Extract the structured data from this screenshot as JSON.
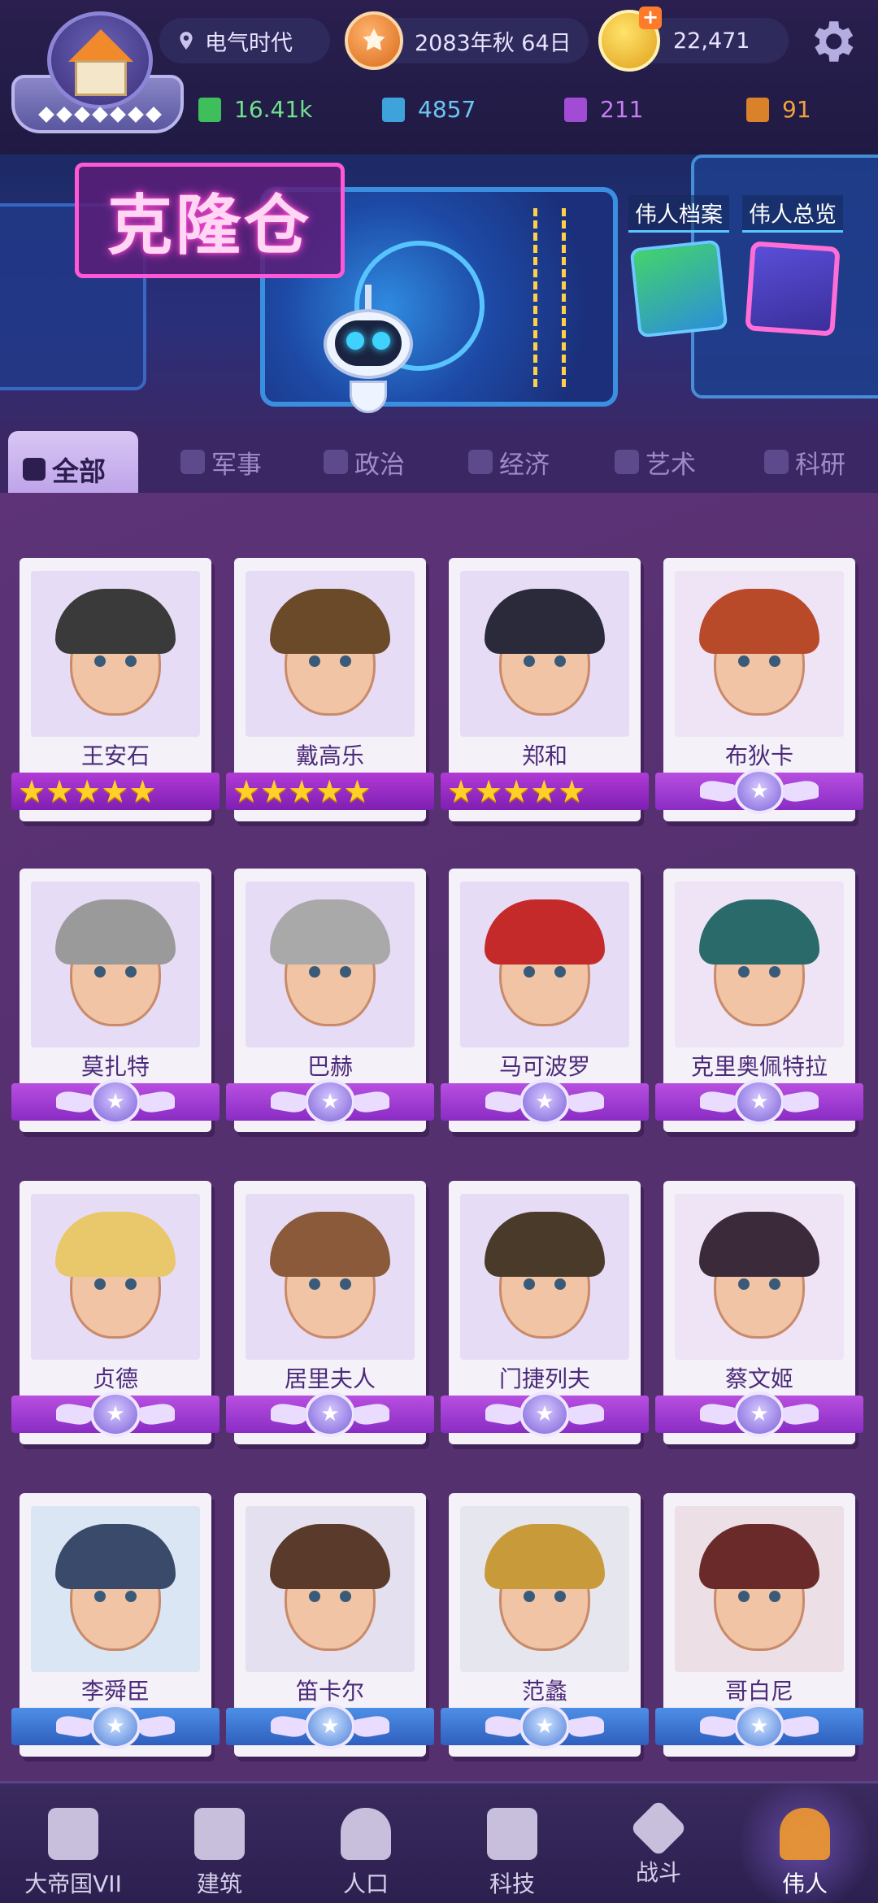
{
  "header": {
    "era": "电气时代",
    "date": "2083年秋 64日",
    "coins": "22,471",
    "resources": [
      {
        "value": "16.41k",
        "icon": "green-resource-icon",
        "color": "#6ee28a"
      },
      {
        "value": "4857",
        "icon": "blue-resource-icon",
        "color": "#6cc6f2"
      },
      {
        "value": "211",
        "icon": "purple-resource-icon",
        "color": "#c87ef0"
      },
      {
        "value": "91",
        "icon": "orange-resource-icon",
        "color": "#f2a33a"
      }
    ]
  },
  "banner": {
    "title": "克隆仓",
    "archive_label": "伟人档案",
    "overview_label": "伟人总览"
  },
  "tabs": [
    {
      "label": "全部",
      "icon": "grid-icon",
      "active": true
    },
    {
      "label": "军事",
      "icon": "shield-icon"
    },
    {
      "label": "政治",
      "icon": "building-icon"
    },
    {
      "label": "经济",
      "icon": "coins-icon"
    },
    {
      "label": "艺术",
      "icon": "palette-icon"
    },
    {
      "label": "科研",
      "icon": "flask-icon"
    }
  ],
  "heroes": [
    {
      "name": "王安石",
      "rank": "stars",
      "stars": 5
    },
    {
      "name": "戴高乐",
      "rank": "stars",
      "stars": 5
    },
    {
      "name": "郑和",
      "rank": "stars",
      "stars": 5
    },
    {
      "name": "布狄卡",
      "rank": "purple"
    },
    {
      "name": "莫扎特",
      "rank": "purple"
    },
    {
      "name": "巴赫",
      "rank": "purple"
    },
    {
      "name": "马可波罗",
      "rank": "purple"
    },
    {
      "name": "克里奥佩特拉",
      "rank": "purple"
    },
    {
      "name": "贞德",
      "rank": "purple"
    },
    {
      "name": "居里夫人",
      "rank": "purple"
    },
    {
      "name": "门捷列夫",
      "rank": "purple"
    },
    {
      "name": "蔡文姬",
      "rank": "purple"
    },
    {
      "name": "李舜臣",
      "rank": "blue"
    },
    {
      "name": "笛卡尔",
      "rank": "blue"
    },
    {
      "name": "范蠡",
      "rank": "blue"
    },
    {
      "name": "哥白尼",
      "rank": "blue"
    }
  ],
  "nav": [
    {
      "label": "大帝国VII",
      "icon": "castle-icon"
    },
    {
      "label": "建筑",
      "icon": "house-icon"
    },
    {
      "label": "人口",
      "icon": "person-icon"
    },
    {
      "label": "科技",
      "icon": "book-icon"
    },
    {
      "label": "战斗",
      "icon": "swords-icon"
    },
    {
      "label": "伟人",
      "icon": "statue-icon",
      "active": true
    }
  ],
  "colors": {
    "accent": "#b84fe0",
    "star": "#ffd027",
    "blue_rank": "#4d8fe6"
  }
}
